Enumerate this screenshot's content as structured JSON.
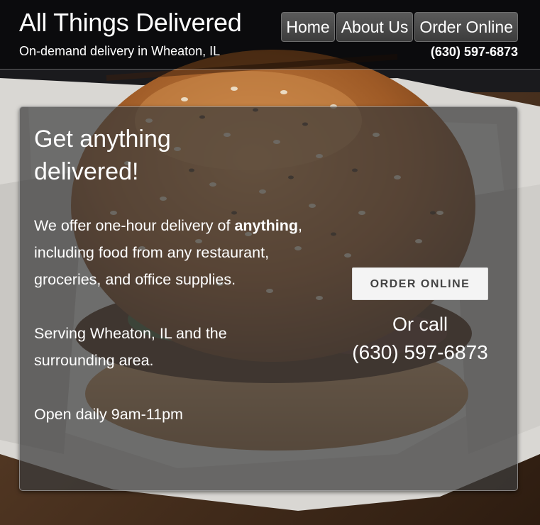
{
  "header": {
    "site_title": "All Things Delivered",
    "tagline": "On-demand delivery in Wheaton, IL",
    "phone": "(630) 597-6873",
    "nav": [
      {
        "label": "Home"
      },
      {
        "label": "About Us"
      },
      {
        "label": "Order Online"
      }
    ]
  },
  "main": {
    "headline": "Get anything delivered!",
    "intro_before": "We offer one-hour delivery of ",
    "intro_bold": "anything",
    "intro_after": ", including food from any restaurant, groceries, and office supplies.",
    "service_area": "Serving Wheaton, IL and the surrounding area.",
    "hours": "Open daily 9am-11pm",
    "order_button": "ORDER ONLINE",
    "or_call": "Or call",
    "phone": "(630) 597-6873"
  },
  "colors": {
    "header_bg": "#000000",
    "panel_bg": "#3c3c3c",
    "button_bg": "#f4f4f4",
    "button_text": "#444444",
    "text": "#ffffff"
  }
}
